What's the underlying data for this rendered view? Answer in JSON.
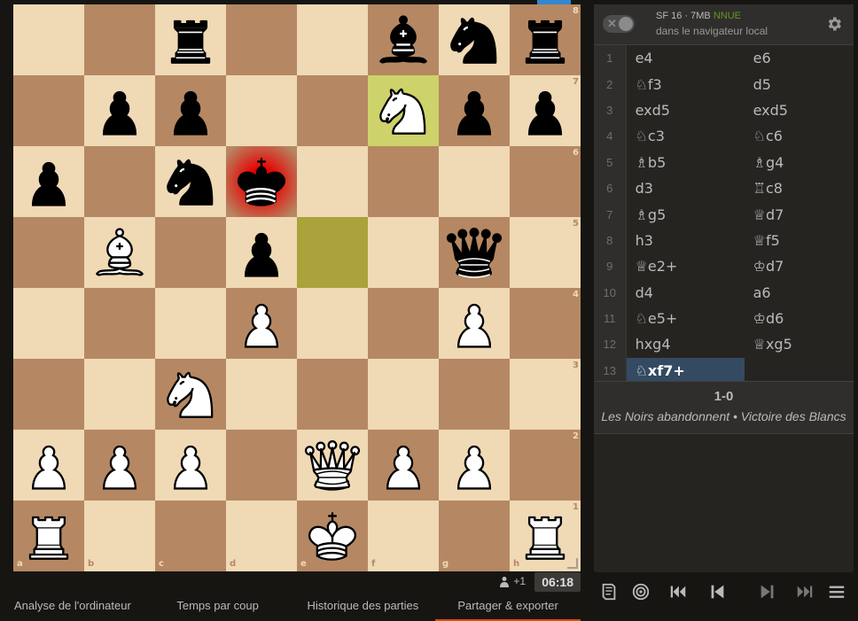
{
  "board": {
    "files": [
      "a",
      "b",
      "c",
      "d",
      "e",
      "f",
      "g",
      "h"
    ],
    "ranks": [
      "8",
      "7",
      "6",
      "5",
      "4",
      "3",
      "2",
      "1"
    ],
    "check_square": "d6",
    "last_move": {
      "from": "f7",
      "to": "e5"
    },
    "pieces": [
      {
        "square": "c8",
        "color": "black",
        "type": "rook"
      },
      {
        "square": "f8",
        "color": "black",
        "type": "bishop"
      },
      {
        "square": "g8",
        "color": "black",
        "type": "knight"
      },
      {
        "square": "h8",
        "color": "black",
        "type": "rook"
      },
      {
        "square": "b7",
        "color": "black",
        "type": "pawn"
      },
      {
        "square": "c7",
        "color": "black",
        "type": "pawn"
      },
      {
        "square": "f7",
        "color": "white",
        "type": "knight"
      },
      {
        "square": "g7",
        "color": "black",
        "type": "pawn"
      },
      {
        "square": "h7",
        "color": "black",
        "type": "pawn"
      },
      {
        "square": "a6",
        "color": "black",
        "type": "pawn"
      },
      {
        "square": "c6",
        "color": "black",
        "type": "knight"
      },
      {
        "square": "d6",
        "color": "black",
        "type": "king"
      },
      {
        "square": "b5",
        "color": "white",
        "type": "bishop"
      },
      {
        "square": "d5",
        "color": "black",
        "type": "pawn"
      },
      {
        "square": "g5",
        "color": "black",
        "type": "queen"
      },
      {
        "square": "d4",
        "color": "white",
        "type": "pawn"
      },
      {
        "square": "g4",
        "color": "white",
        "type": "pawn"
      },
      {
        "square": "c3",
        "color": "white",
        "type": "knight"
      },
      {
        "square": "a2",
        "color": "white",
        "type": "pawn"
      },
      {
        "square": "b2",
        "color": "white",
        "type": "pawn"
      },
      {
        "square": "c2",
        "color": "white",
        "type": "pawn"
      },
      {
        "square": "e2",
        "color": "white",
        "type": "queen"
      },
      {
        "square": "f2",
        "color": "white",
        "type": "pawn"
      },
      {
        "square": "g2",
        "color": "white",
        "type": "pawn"
      },
      {
        "square": "a1",
        "color": "white",
        "type": "rook"
      },
      {
        "square": "e1",
        "color": "white",
        "type": "king"
      },
      {
        "square": "h1",
        "color": "white",
        "type": "rook"
      }
    ]
  },
  "engine": {
    "name": "SF 16 · 7MB",
    "tag": "NNUE",
    "location": "dans le navigateur local"
  },
  "moves": [
    {
      "n": "1",
      "w": "e4",
      "b": "e6"
    },
    {
      "n": "2",
      "w": "♘f3",
      "b": "d5"
    },
    {
      "n": "3",
      "w": "exd5",
      "b": "exd5"
    },
    {
      "n": "4",
      "w": "♘c3",
      "b": "♘c6"
    },
    {
      "n": "5",
      "w": "♗b5",
      "b": "♗g4"
    },
    {
      "n": "6",
      "w": "d3",
      "b": "♖c8"
    },
    {
      "n": "7",
      "w": "♗g5",
      "b": "♕d7"
    },
    {
      "n": "8",
      "w": "h3",
      "b": "♕f5"
    },
    {
      "n": "9",
      "w": "♕e2+",
      "b": "♔d7"
    },
    {
      "n": "10",
      "w": "d4",
      "b": "a6"
    },
    {
      "n": "11",
      "w": "♘e5+",
      "b": "♔d6"
    },
    {
      "n": "12",
      "w": "hxg4",
      "b": "♕xg5"
    },
    {
      "n": "13",
      "w": "♘xf7+",
      "b": ""
    }
  ],
  "result": {
    "score": "1-0",
    "description": "Les Noirs abandonnent • Victoire des Blancs"
  },
  "under_board": {
    "spectators": "+1",
    "clock": "06:18"
  },
  "tabs": [
    {
      "label": "Analyse de l'ordinateur",
      "active": false
    },
    {
      "label": "Temps par coup",
      "active": false
    },
    {
      "label": "Historique des parties",
      "active": false
    },
    {
      "label": "Partager & exporter",
      "active": true
    }
  ],
  "colors": {
    "light_square": "#f0d9b5",
    "dark_square": "#b58863",
    "last_move_from": "#cdd26a",
    "last_move_to": "#aaa23a",
    "active_move": "#334a62",
    "nnue": "#629924",
    "active_tab": "#d85000"
  },
  "controls": [
    "book-icon",
    "target-icon",
    "first-move-icon",
    "previous-move-icon",
    "next-move-icon",
    "last-move-icon",
    "menu-icon"
  ]
}
